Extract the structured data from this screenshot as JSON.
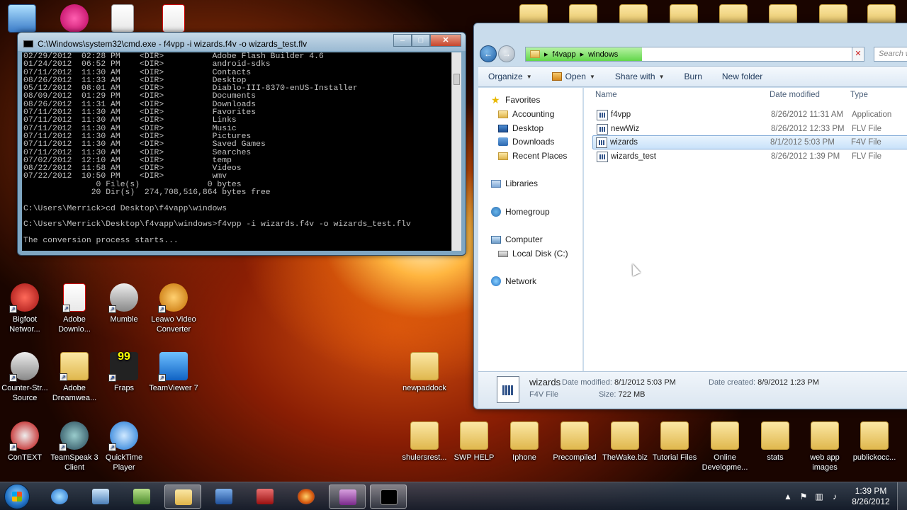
{
  "desktop_icons": [
    {
      "label": "Bigfoot Networ...",
      "kind": "app"
    },
    {
      "label": "Adobe Downlo...",
      "kind": "doc"
    },
    {
      "label": "Mumble",
      "kind": "app"
    },
    {
      "label": "Leawo Video Converter",
      "kind": "app"
    },
    {
      "label": "Counter-Str... Source",
      "kind": "app"
    },
    {
      "label": "Adobe Dreamwea...",
      "kind": "doc"
    },
    {
      "label": "Fraps",
      "kind": "app"
    },
    {
      "label": "TeamViewer 7",
      "kind": "app"
    },
    {
      "label": "ConTEXT",
      "kind": "app"
    },
    {
      "label": "TeamSpeak 3 Client",
      "kind": "app"
    },
    {
      "label": "QuickTime Player",
      "kind": "app"
    },
    {
      "label": "newpaddock",
      "kind": "folder"
    },
    {
      "label": "shulersrest...",
      "kind": "folder"
    },
    {
      "label": "SWP HELP",
      "kind": "folder"
    },
    {
      "label": "Iphone",
      "kind": "folder"
    },
    {
      "label": "Precompiled",
      "kind": "folder"
    },
    {
      "label": "TheWake.biz",
      "kind": "folder"
    },
    {
      "label": "Tutorial Files",
      "kind": "folder"
    },
    {
      "label": "Online Developme...",
      "kind": "folder"
    },
    {
      "label": "stats",
      "kind": "folder"
    },
    {
      "label": "web app images",
      "kind": "folder"
    },
    {
      "label": "publickocc...",
      "kind": "folder"
    }
  ],
  "cmd": {
    "title": "C:\\Windows\\system32\\cmd.exe - f4vpp  -i wizards.f4v -o wizards_test.flv",
    "lines": [
      "02/29/2012  02:28 PM    <DIR>          Adobe Flash Builder 4.6",
      "01/24/2012  06:52 PM    <DIR>          android-sdks",
      "07/11/2012  11:30 AM    <DIR>          Contacts",
      "08/26/2012  11:33 AM    <DIR>          Desktop",
      "05/12/2012  08:01 AM    <DIR>          Diablo-III-8370-enUS-Installer",
      "08/09/2012  01:29 PM    <DIR>          Documents",
      "08/26/2012  11:31 AM    <DIR>          Downloads",
      "07/11/2012  11:30 AM    <DIR>          Favorites",
      "07/11/2012  11:30 AM    <DIR>          Links",
      "07/11/2012  11:30 AM    <DIR>          Music",
      "07/11/2012  11:30 AM    <DIR>          Pictures",
      "07/11/2012  11:30 AM    <DIR>          Saved Games",
      "07/11/2012  11:30 AM    <DIR>          Searches",
      "07/02/2012  12:10 AM    <DIR>          temp",
      "08/22/2012  11:58 AM    <DIR>          Videos",
      "07/22/2012  10:50 PM    <DIR>          wmv",
      "               0 File(s)              0 bytes",
      "              20 Dir(s)  274,708,516,864 bytes free",
      "",
      "C:\\Users\\Merrick>cd Desktop\\f4vapp\\windows",
      "",
      "C:\\Users\\Merrick\\Desktop\\f4vapp\\windows>f4vpp -i wizards.f4v -o wizards_test.flv",
      "",
      "The conversion process starts..."
    ]
  },
  "explorer": {
    "breadcrumb": [
      "f4vapp",
      "windows"
    ],
    "search_placeholder": "Search wi...",
    "toolbar": [
      "Organize",
      "Open",
      "Share with",
      "Burn",
      "New folder"
    ],
    "nav": [
      {
        "label": "Favorites",
        "icon": "star-icon"
      },
      {
        "label": "Accounting",
        "icon": "folder-icon"
      },
      {
        "label": "Desktop",
        "icon": "desktop-icon"
      },
      {
        "label": "Downloads",
        "icon": "downloads-icon"
      },
      {
        "label": "Recent Places",
        "icon": "folder-icon"
      },
      {
        "label": "Libraries",
        "icon": "library-icon"
      },
      {
        "label": "Homegroup",
        "icon": "homegroup-icon"
      },
      {
        "label": "Computer",
        "icon": "computer-icon"
      },
      {
        "label": "Local Disk (C:)",
        "icon": "disk-icon"
      },
      {
        "label": "Network",
        "icon": "network-icon"
      }
    ],
    "columns": [
      "Name",
      "Date modified",
      "Type"
    ],
    "files": [
      {
        "name": "f4vpp",
        "date": "8/26/2012 11:31 AM",
        "type": "Application"
      },
      {
        "name": "newWiz",
        "date": "8/26/2012 12:33 PM",
        "type": "FLV File"
      },
      {
        "name": "wizards",
        "date": "8/1/2012 5:03 PM",
        "type": "F4V File",
        "selected": true
      },
      {
        "name": "wizards_test",
        "date": "8/26/2012 1:39 PM",
        "type": "FLV File"
      }
    ],
    "details": {
      "name": "wizards",
      "kind": "F4V File",
      "modified_label": "Date modified:",
      "modified": "8/1/2012 5:03 PM",
      "created_label": "Date created:",
      "created": "8/9/2012 1:23 PM",
      "size_label": "Size:",
      "size": "722 MB"
    }
  },
  "taskbar": {
    "time": "1:39 PM",
    "date": "8/26/2012",
    "apps": [
      "itunes-icon",
      "network-tool-icon",
      "game-icon",
      "explorer-icon",
      "word-icon",
      "acrobat-icon",
      "firefox-icon",
      "flash-builder-icon",
      "cmd-icon"
    ]
  }
}
